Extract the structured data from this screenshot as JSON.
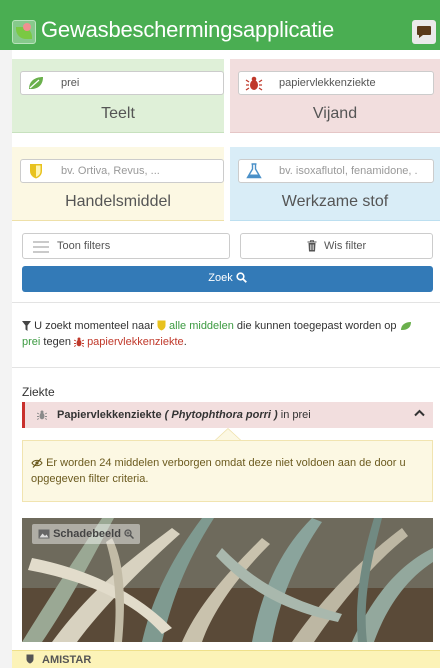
{
  "header": {
    "title": "Gewasbeschermingsapplicatie",
    "brand_color": "#4aae52"
  },
  "crop": {
    "value": "prei",
    "label": "Teelt"
  },
  "enemy": {
    "value": "papiervlekkenziekte",
    "label": "Vijand"
  },
  "product": {
    "placeholder": "bv. Ortiva, Revus, ...",
    "label": "Handelsmiddel"
  },
  "substance": {
    "placeholder": "bv. isoxaflutol, fenamidone, .",
    "label": "Werkzame stof"
  },
  "buttons": {
    "filters": "Toon filters",
    "clear": "Wis filter",
    "search": "Zoek"
  },
  "summary": {
    "prefix": "U zoekt momenteel naar",
    "all_products": "alle middelen",
    "middle": "die kunnen toegepast worden op",
    "crop": "prei",
    "against": "tegen",
    "enemy": "papiervlekkenziekte",
    "end": "."
  },
  "disease": {
    "section_label": "Ziekte",
    "name": "Papiervlekkenziekte",
    "latin": "( Phytophthora porri )",
    "in_text": "in prei"
  },
  "warning": "Er worden 24 middelen verborgen omdat deze niet voldoen aan de door u opgegeven filter criteria.",
  "photo": {
    "badge": "Schadebeeld"
  },
  "first_product": "AMISTAR",
  "icons": [
    "leaf-icon",
    "bug-icon",
    "shield-icon",
    "flask-icon",
    "menu-icon",
    "trash-icon",
    "search-icon",
    "filter-icon",
    "chevron-up-icon",
    "eye-slash-icon",
    "image-icon",
    "zoom-icon",
    "chat-icon"
  ]
}
